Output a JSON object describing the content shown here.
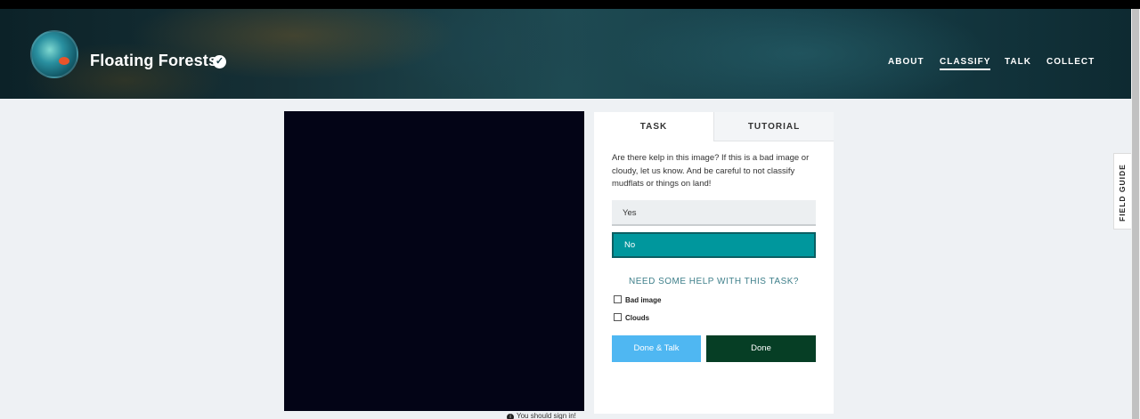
{
  "header": {
    "project_name": "Floating Forests",
    "verified_icon": "check-circle-icon",
    "nav": [
      "ABOUT",
      "CLASSIFY",
      "TALK",
      "COLLECT"
    ],
    "active_nav": "CLASSIFY"
  },
  "subject": {
    "notice": "You should sign in!"
  },
  "task_panel": {
    "tabs": [
      "TASK",
      "TUTORIAL"
    ],
    "active_tab": "TASK",
    "question": "Are there kelp in this image? If this is a bad image or cloudy, let us know. And be careful to not classify mudflats or things on land!",
    "answers": [
      "Yes",
      "No"
    ],
    "selected_answer": "No",
    "help_link": "NEED SOME HELP WITH THIS TASK?",
    "checkboxes": [
      "Bad image",
      "Clouds"
    ],
    "done_talk_label": "Done & Talk",
    "done_label": "Done"
  },
  "field_guide": {
    "label": "FIELD GUIDE"
  },
  "colors": {
    "selected_answer": "#00979d",
    "done_talk": "#4fb7f2",
    "done": "#063e25"
  }
}
